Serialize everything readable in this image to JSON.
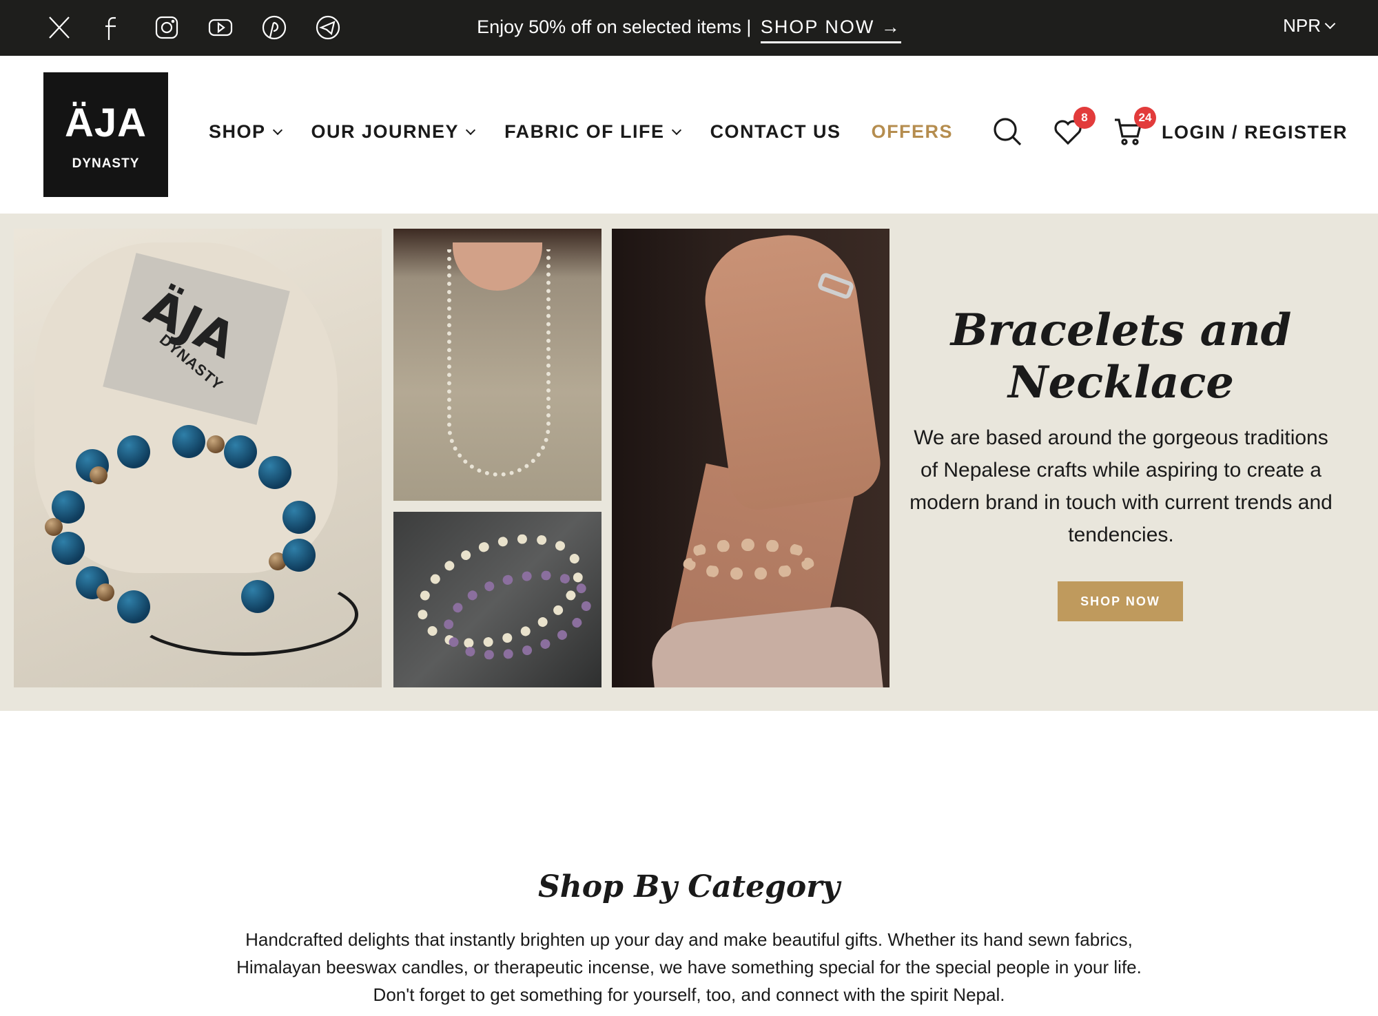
{
  "topbar": {
    "socials": [
      {
        "icon": "x-twitter-icon"
      },
      {
        "icon": "facebook-icon"
      },
      {
        "icon": "instagram-icon"
      },
      {
        "icon": "youtube-icon"
      },
      {
        "icon": "pinterest-icon"
      },
      {
        "icon": "telegram-icon"
      }
    ],
    "promo_text": "Enjoy 50% off on selected items |",
    "promo_link": "SHOP NOW →",
    "currency": "NPR"
  },
  "header": {
    "logo_line1": "ÄJA",
    "logo_line2": "DYNASTY",
    "nav": [
      {
        "label": "SHOP",
        "has_dropdown": true
      },
      {
        "label": "OUR JOURNEY",
        "has_dropdown": true
      },
      {
        "label": "FABRIC OF LIFE",
        "has_dropdown": true
      },
      {
        "label": "CONTACT US",
        "has_dropdown": false
      },
      {
        "label": "OFFERS",
        "has_dropdown": false
      }
    ],
    "wishlist_count": "8",
    "cart_count": "24",
    "login_label": "LOGIN / REGISTER"
  },
  "hero": {
    "title_line1": "Bracelets and",
    "title_line2": "Necklace",
    "description": "We are based around the gorgeous traditions of Nepalese crafts while aspiring to create a modern brand in touch with current trends and tendencies.",
    "button_label": "SHOP NOW",
    "photo_tag_line1": "ÄJA",
    "photo_tag_line2": "DYNASTY"
  },
  "category": {
    "title": "Shop By Category",
    "description": "Handcrafted delights that instantly brighten up your day and make beautiful gifts. Whether its hand sewn fabrics, Himalayan beeswax candles, or therapeutic incense, we have something special for the special people in your life. Don't forget to get something for yourself, too, and connect with the spirit Nepal."
  },
  "colors": {
    "accent": "#bf9a5d",
    "offers": "#b58d4f",
    "topbar_bg": "#1e1e1c",
    "badge": "#e23b3b",
    "hero_bg": "#e9e6dc"
  }
}
